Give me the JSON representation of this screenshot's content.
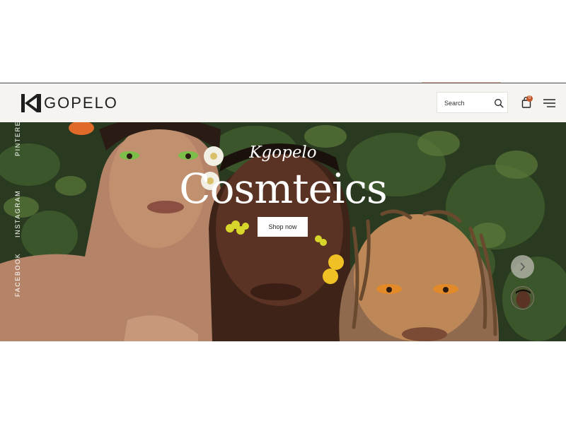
{
  "header": {
    "logo_text": "GOPELO",
    "search_placeholder": "Search",
    "cart_count": "0"
  },
  "icons": {
    "logo": "kgopelo-logo-mark",
    "search": "search-icon",
    "cart": "shopping-bag-icon",
    "menu": "hamburger-menu-icon",
    "next": "chevron-right-icon"
  },
  "social": {
    "pinterest": "PINTEREST",
    "instagram": "INSTAGRAM",
    "facebook": "FACEBOOK"
  },
  "hero": {
    "script_title": "Kgopelo",
    "title": "Cosmteics",
    "cta_label": "Shop now"
  },
  "colors": {
    "header_bg": "#f6f4f1",
    "accent": "#c4582d",
    "text_dark": "#1e1e1e"
  }
}
